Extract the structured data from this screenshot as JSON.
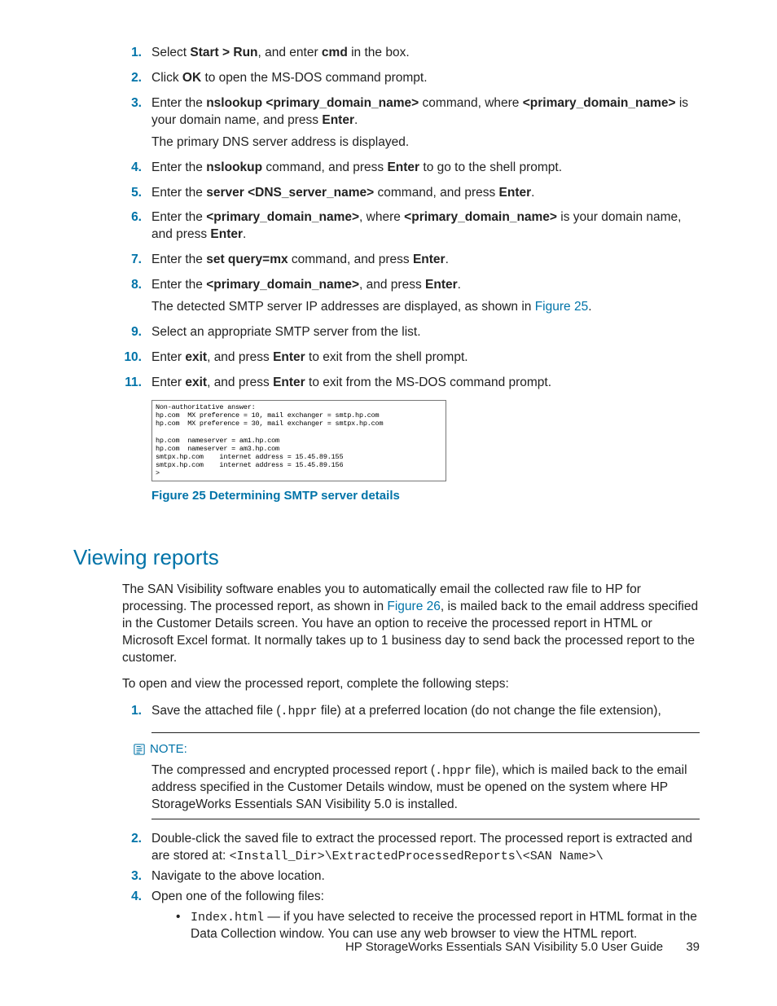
{
  "list1": {
    "items": [
      {
        "num": "1.",
        "html": "Select <b>Start > Run</b>, and enter <b>cmd</b> in the box."
      },
      {
        "num": "2.",
        "html": "Click <b>OK</b> to open the MS-DOS command prompt."
      },
      {
        "num": "3.",
        "html": "Enter the <b>nslookup &lt;primary_domain_name&gt;</b> command, where <b>&lt;primary_domain_name&gt;</b> is your domain name, and press <b>Enter</b>.",
        "extra": "The primary DNS server address is displayed."
      },
      {
        "num": "4.",
        "html": "Enter the <b>nslookup</b> command, and press <b>Enter</b> to go to the shell prompt."
      },
      {
        "num": "5.",
        "html": "Enter the <b>server &lt;DNS_server_name&gt;</b> command, and press <b>Enter</b>."
      },
      {
        "num": "6.",
        "html": "Enter the <b>&lt;primary_domain_name&gt;</b>, where <b>&lt;primary_domain_name&gt;</b> is your domain name, and press <b>Enter</b>."
      },
      {
        "num": "7.",
        "html": "Enter the <b>set query=mx</b> command, and press <b>Enter</b>."
      },
      {
        "num": "8.",
        "html": "Enter the <b>&lt;primary_domain_name&gt;</b>, and press <b>Enter</b>.",
        "extra_html": "The detected SMTP server IP addresses are displayed, as shown in <span class='link'>Figure 25</span>."
      },
      {
        "num": "9.",
        "html": "Select an appropriate SMTP server from the list."
      },
      {
        "num": "10.",
        "html": "Enter <b>exit</b>, and press <b>Enter</b> to exit from the shell prompt."
      },
      {
        "num": "11.",
        "html": "Enter <b>exit</b>, and press <b>Enter</b> to exit from the MS-DOS command prompt."
      }
    ]
  },
  "figure25": {
    "text": "Non-authoritative answer:\nhp.com  MX preference = 10, mail exchanger = smtp.hp.com\nhp.com  MX preference = 30, mail exchanger = smtpx.hp.com\n\nhp.com  nameserver = am1.hp.com\nhp.com  nameserver = am3.hp.com\nsmtpx.hp.com    internet address = 15.45.89.155\nsmtpx.hp.com    internet address = 15.45.89.156\n>",
    "caption": "Figure 25 Determining SMTP server details"
  },
  "section": {
    "title": "Viewing reports",
    "p1_html": "The SAN Visibility software enables you to automatically email the collected raw file to HP for processing. The processed report, as shown in <span class='link'>Figure 26</span>, is mailed back to the email address specified in the Customer Details screen. You have an option to receive the processed report in HTML or Microsoft Excel format. It normally takes up to 1 business day to send back the processed report to the customer.",
    "p2": "To open and view the processed report, complete the following steps:"
  },
  "list2": {
    "items": [
      {
        "num": "1.",
        "html": "Save the attached file (<span class='mono'>.hppr</span> file) at a preferred location (do not change the file extension),"
      },
      {
        "num": "2.",
        "html": "Double-click the saved file to extract the processed report. The processed report is extracted and are stored at: <span class='mono'>&lt;Install_Dir&gt;\\ExtractedProcessedReports\\&lt;SAN Name&gt;\\</span>"
      },
      {
        "num": "3.",
        "html": "Navigate to the above location."
      },
      {
        "num": "4.",
        "html": "Open one of the following files:"
      }
    ],
    "bullet_html": "<span class='mono'>Index.html</span> — if you have selected to receive the processed report in HTML format in the Data Collection window. You can use any web browser to view the HTML report."
  },
  "note": {
    "label": "NOTE:",
    "text_html": "The compressed and encrypted processed report (<span class='mono'>.hppr</span> file), which is mailed back to the email address specified in the Customer Details window, must be opened on the system where HP StorageWorks Essentials SAN Visibility 5.0 is installed."
  },
  "footer": {
    "text": "HP StorageWorks Essentials SAN Visibility 5.0 User Guide",
    "page": "39"
  }
}
